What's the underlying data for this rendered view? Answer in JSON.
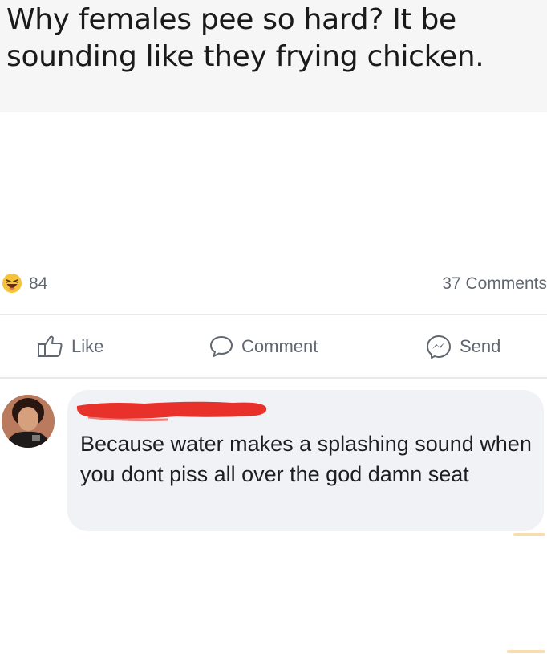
{
  "post": {
    "text": "Why females pee so hard? It be sounding like they frying chicken."
  },
  "stats": {
    "reaction_icon": "haha-emoji-icon",
    "reaction_count": "84",
    "comments_count": "37 Comments"
  },
  "actions": {
    "like_label": "Like",
    "comment_label": "Comment",
    "send_label": "Send"
  },
  "comment": {
    "author_redacted": true,
    "text": "Because water makes a splashing sound when you dont piss all over the god damn seat"
  },
  "colors": {
    "action_gray": "#606770",
    "bubble_bg": "#f0f2f5",
    "redaction_red": "#e8312a"
  }
}
